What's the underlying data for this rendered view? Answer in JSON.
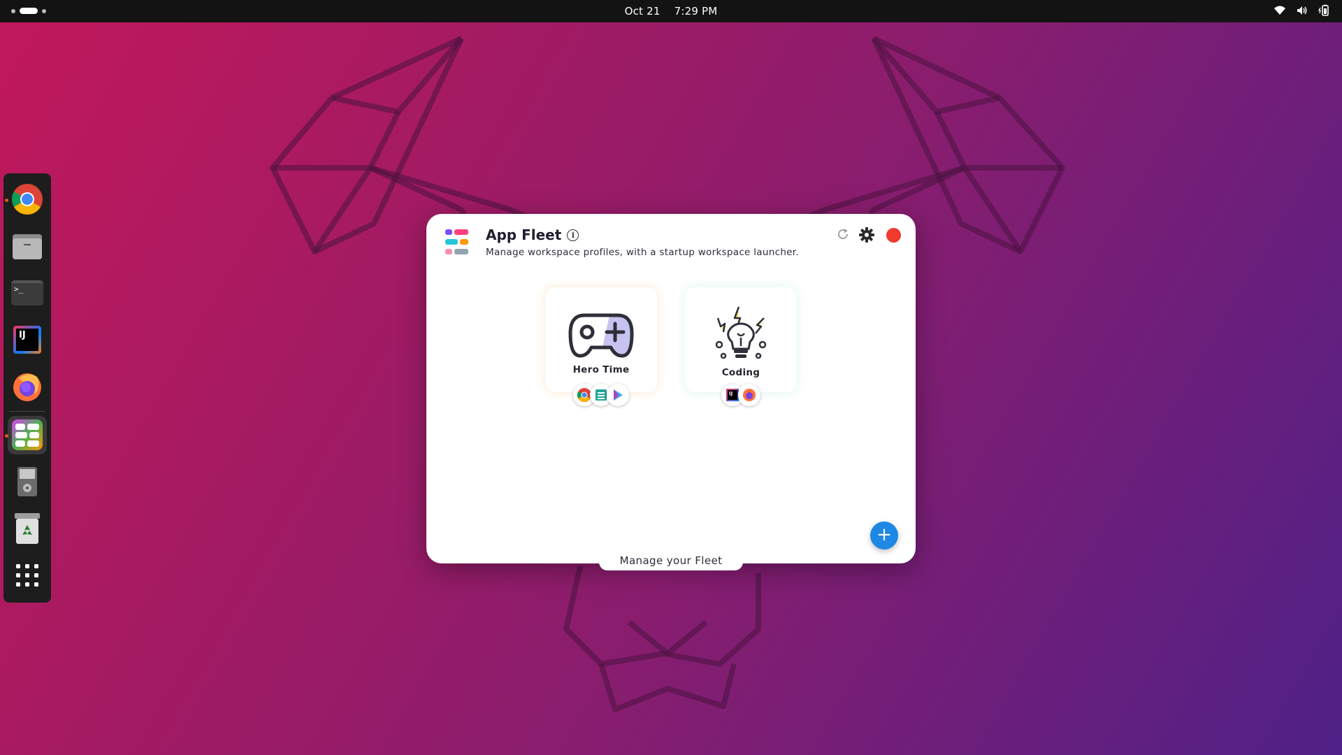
{
  "topbar": {
    "date": "Oct 21",
    "time": "7:29 PM",
    "tray_icons": [
      "wifi-icon",
      "volume-icon",
      "battery-icon"
    ]
  },
  "dock": {
    "items": [
      {
        "name": "chrome",
        "icon": "chrome-icon",
        "running": true
      },
      {
        "name": "files",
        "icon": "folder-icon",
        "running": false
      },
      {
        "name": "terminal",
        "icon": "terminal-icon",
        "running": false
      },
      {
        "name": "intellij",
        "icon": "intellij-icon",
        "running": false
      },
      {
        "name": "firefox",
        "icon": "firefox-icon",
        "running": false
      },
      {
        "name": "app-fleet",
        "icon": "app-fleet-icon",
        "running": true,
        "active": true
      },
      {
        "name": "drive",
        "icon": "drive-icon",
        "running": false
      },
      {
        "name": "trash",
        "icon": "trash-icon",
        "running": false
      },
      {
        "name": "show-apps",
        "icon": "app-grid-icon",
        "running": false
      }
    ],
    "terminal_glyph": ">_",
    "intellij_glyph": "IJ"
  },
  "app": {
    "title": "App Fleet",
    "info_glyph": "i",
    "subtitle": "Manage workspace profiles, with a startup workspace launcher.",
    "profiles": [
      {
        "name": "Hero Time",
        "icon": "gamepad-icon",
        "apps": [
          "chrome-icon",
          "sheet-icon",
          "play-icon"
        ]
      },
      {
        "name": "Coding",
        "icon": "lightbulb-icon",
        "apps": [
          "intellij-icon",
          "firefox-icon"
        ]
      }
    ],
    "add_label": "+",
    "manage_label": "Manage your Fleet",
    "colors": {
      "accent": "#1e88e5",
      "close": "#f13a2e"
    }
  }
}
